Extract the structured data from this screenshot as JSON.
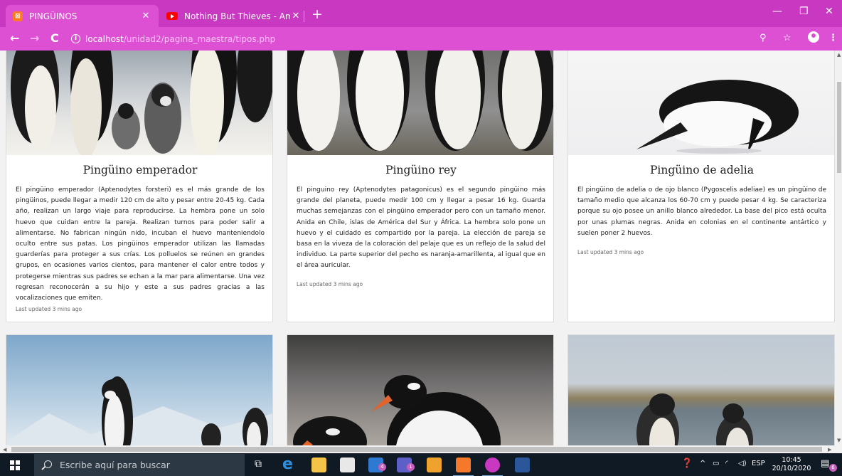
{
  "browser": {
    "tabs": [
      {
        "title": "PINGÜINOS",
        "favicon": "xampp-icon",
        "active": true
      },
      {
        "title": "Nothing But Thieves - Amsterdam",
        "favicon": "youtube-icon",
        "active": false
      }
    ],
    "new_tab_label": "+",
    "url_host": "localhost",
    "url_path": "/unidad2/pagina_maestra/tipos.php",
    "accent_color": "#dd50d3"
  },
  "cards": [
    {
      "title": "Pingüino emperador",
      "text": "El pingüino emperador (Aptenodytes forsteri) es el más grande de los pingüinos, puede llegar a medir 120 cm de alto y pesar entre 20-45 kg. Cada año, realizan un largo viaje para reproducirse. La hembra pone un solo huevo que cuidan entre la pareja. Realizan turnos para poder salir a alimentarse. No fabrican ningún nido, incuban el huevo manteniendolo oculto entre sus patas. Los pingüinos emperador utilizan las llamadas guarderías para proteger a sus crías. Los polluelos se reúnen en grandes grupos, en ocasiones varios cientos, para mantener el calor entre todos y protegerse mientras sus padres se echan a la mar para alimentarse. Una vez regresan reconocerán a su hijo y este a sus padres gracias a las vocalizaciones que emiten.",
      "meta": "Last updated 3 mins ago"
    },
    {
      "title": "Pingüino rey",
      "text": "El pinguino rey (Aptenodytes patagonicus) es el segundo pingüino más grande del planeta, puede medir 100 cm y llegar a pesar 16 kg. Guarda muchas semejanzas con el pingüino emperador pero con un tamaño menor. Anida en Chile, islas de América del Sur y África. La hembra solo pone un huevo y el cuidado es compartido por la pareja. La elección de pareja se basa en la viveza de la coloración del pelaje que es un reflejo de la salud del individuo. La parte superior del pecho es naranja-amarillenta, al igual que en el área auricular.",
      "meta": "Last updated 3 mins ago"
    },
    {
      "title": "Pingüino de adelia",
      "text": "El pingüino de adelia o de ojo blanco (Pygoscelis adeliae) es un pingüino de tamaño medio que alcanza los 60-70 cm y puede pesar 4 kg. Se caracteriza porque su ojo posee un anillo blanco alrededor. La base del pico está oculta por unas plumas negras. Anida en colonias en el continente antártico y suelen poner 2 huevos.",
      "meta": "Last updated 3 mins ago"
    }
  ],
  "taskbar": {
    "search_placeholder": "Escribe aquí para buscar",
    "language": "ESP",
    "time": "10:45",
    "date": "20/10/2020",
    "mail_badge": "4",
    "teams_badge": "1",
    "notification_badge": "6"
  }
}
